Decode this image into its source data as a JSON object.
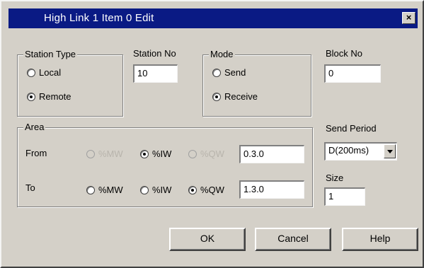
{
  "window": {
    "title": "High Link 1 Item  0  Edit",
    "close_glyph": "×"
  },
  "station_type": {
    "title": "Station Type",
    "options": [
      {
        "label": "Local",
        "checked": false
      },
      {
        "label": "Remote",
        "checked": true
      }
    ]
  },
  "station_no": {
    "label": "Station No",
    "value": "10"
  },
  "mode": {
    "title": "Mode",
    "options": [
      {
        "label": "Send",
        "checked": false
      },
      {
        "label": "Receive",
        "checked": true
      }
    ]
  },
  "block_no": {
    "label": "Block No",
    "value": "0"
  },
  "area": {
    "title": "Area",
    "from": {
      "label": "From",
      "options": [
        {
          "label": "%MW",
          "checked": false,
          "enabled": false
        },
        {
          "label": "%IW",
          "checked": true,
          "enabled": true
        },
        {
          "label": "%QW",
          "checked": false,
          "enabled": false
        }
      ],
      "value": "0.3.0"
    },
    "to": {
      "label": "To",
      "options": [
        {
          "label": "%MW",
          "checked": false,
          "enabled": true
        },
        {
          "label": "%IW",
          "checked": false,
          "enabled": true
        },
        {
          "label": "%QW",
          "checked": true,
          "enabled": true
        }
      ],
      "value": "1.3.0"
    }
  },
  "send_period": {
    "label": "Send Period",
    "value": "D(200ms)"
  },
  "size": {
    "label": "Size",
    "value": "1"
  },
  "buttons": {
    "ok": "OK",
    "cancel": "Cancel",
    "help": "Help"
  },
  "colors": {
    "titlebar": "#0a1a84",
    "face": "#d4d0c8"
  },
  "icons": {
    "close": "close-icon",
    "dropdown": "chevron-down-icon"
  }
}
